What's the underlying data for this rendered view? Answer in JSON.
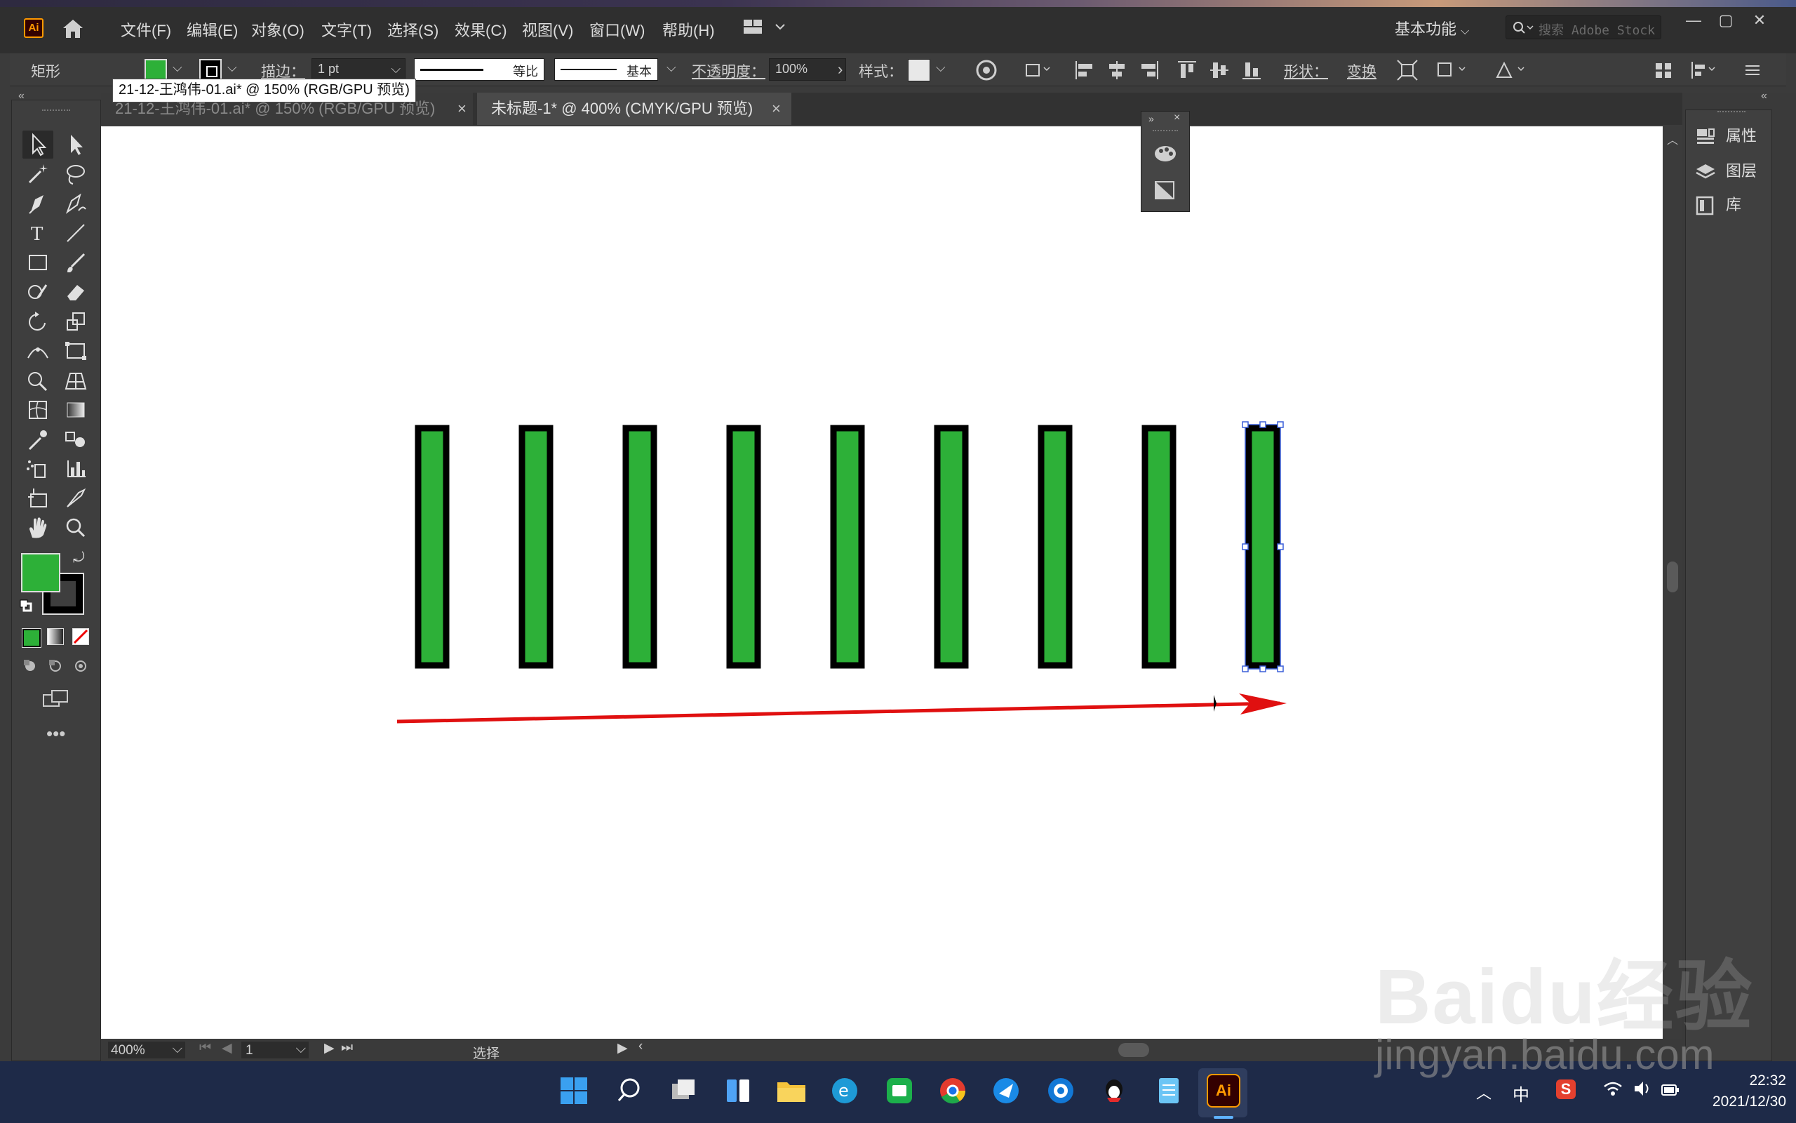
{
  "menubar": {
    "logo": "Ai",
    "items": [
      "文件(F)",
      "编辑(E)",
      "对象(O)",
      "文字(T)",
      "选择(S)",
      "效果(C)",
      "视图(V)",
      "窗口(W)",
      "帮助(H)"
    ],
    "workspace": "基本功能",
    "search_placeholder": "搜索 Adobe Stock"
  },
  "control_bar": {
    "object_type": "矩形",
    "fill_color": "#2db038",
    "stroke_color": "#000000",
    "stroke_label": "描边：",
    "stroke_weight": "1 pt",
    "profile_label": "等比",
    "brush_label": "基本",
    "opacity_label": "不透明度：",
    "opacity_value": "100%",
    "style_label": "样式：",
    "shape_label": "形状：",
    "transform_label": "变换"
  },
  "tabs": [
    {
      "label": "21-12-王鸿伟-01.ai* @ 150% (RGB/GPU 预览)",
      "active": false
    },
    {
      "label": "未标题-1* @ 400% (CMYK/GPU 预览)",
      "active": true
    }
  ],
  "tooltip": "21-12-王鸿伟-01.ai* @ 150% (RGB/GPU 预览)",
  "right_panel": {
    "items": [
      "属性",
      "图层",
      "库"
    ]
  },
  "status_bar": {
    "zoom": "400%",
    "artboard": "1",
    "tool": "选择"
  },
  "artwork": {
    "rect_fill": "#2db038",
    "rect_stroke": "#000000",
    "rect_count": 9,
    "selected_index": 8,
    "arrow_color": "#e01010"
  },
  "taskbar": {
    "ime": "中",
    "time": "22:32",
    "date": "2021/12/30"
  },
  "watermark": {
    "logo": "Baidu经验",
    "site": "jingyan.baidu.com"
  }
}
